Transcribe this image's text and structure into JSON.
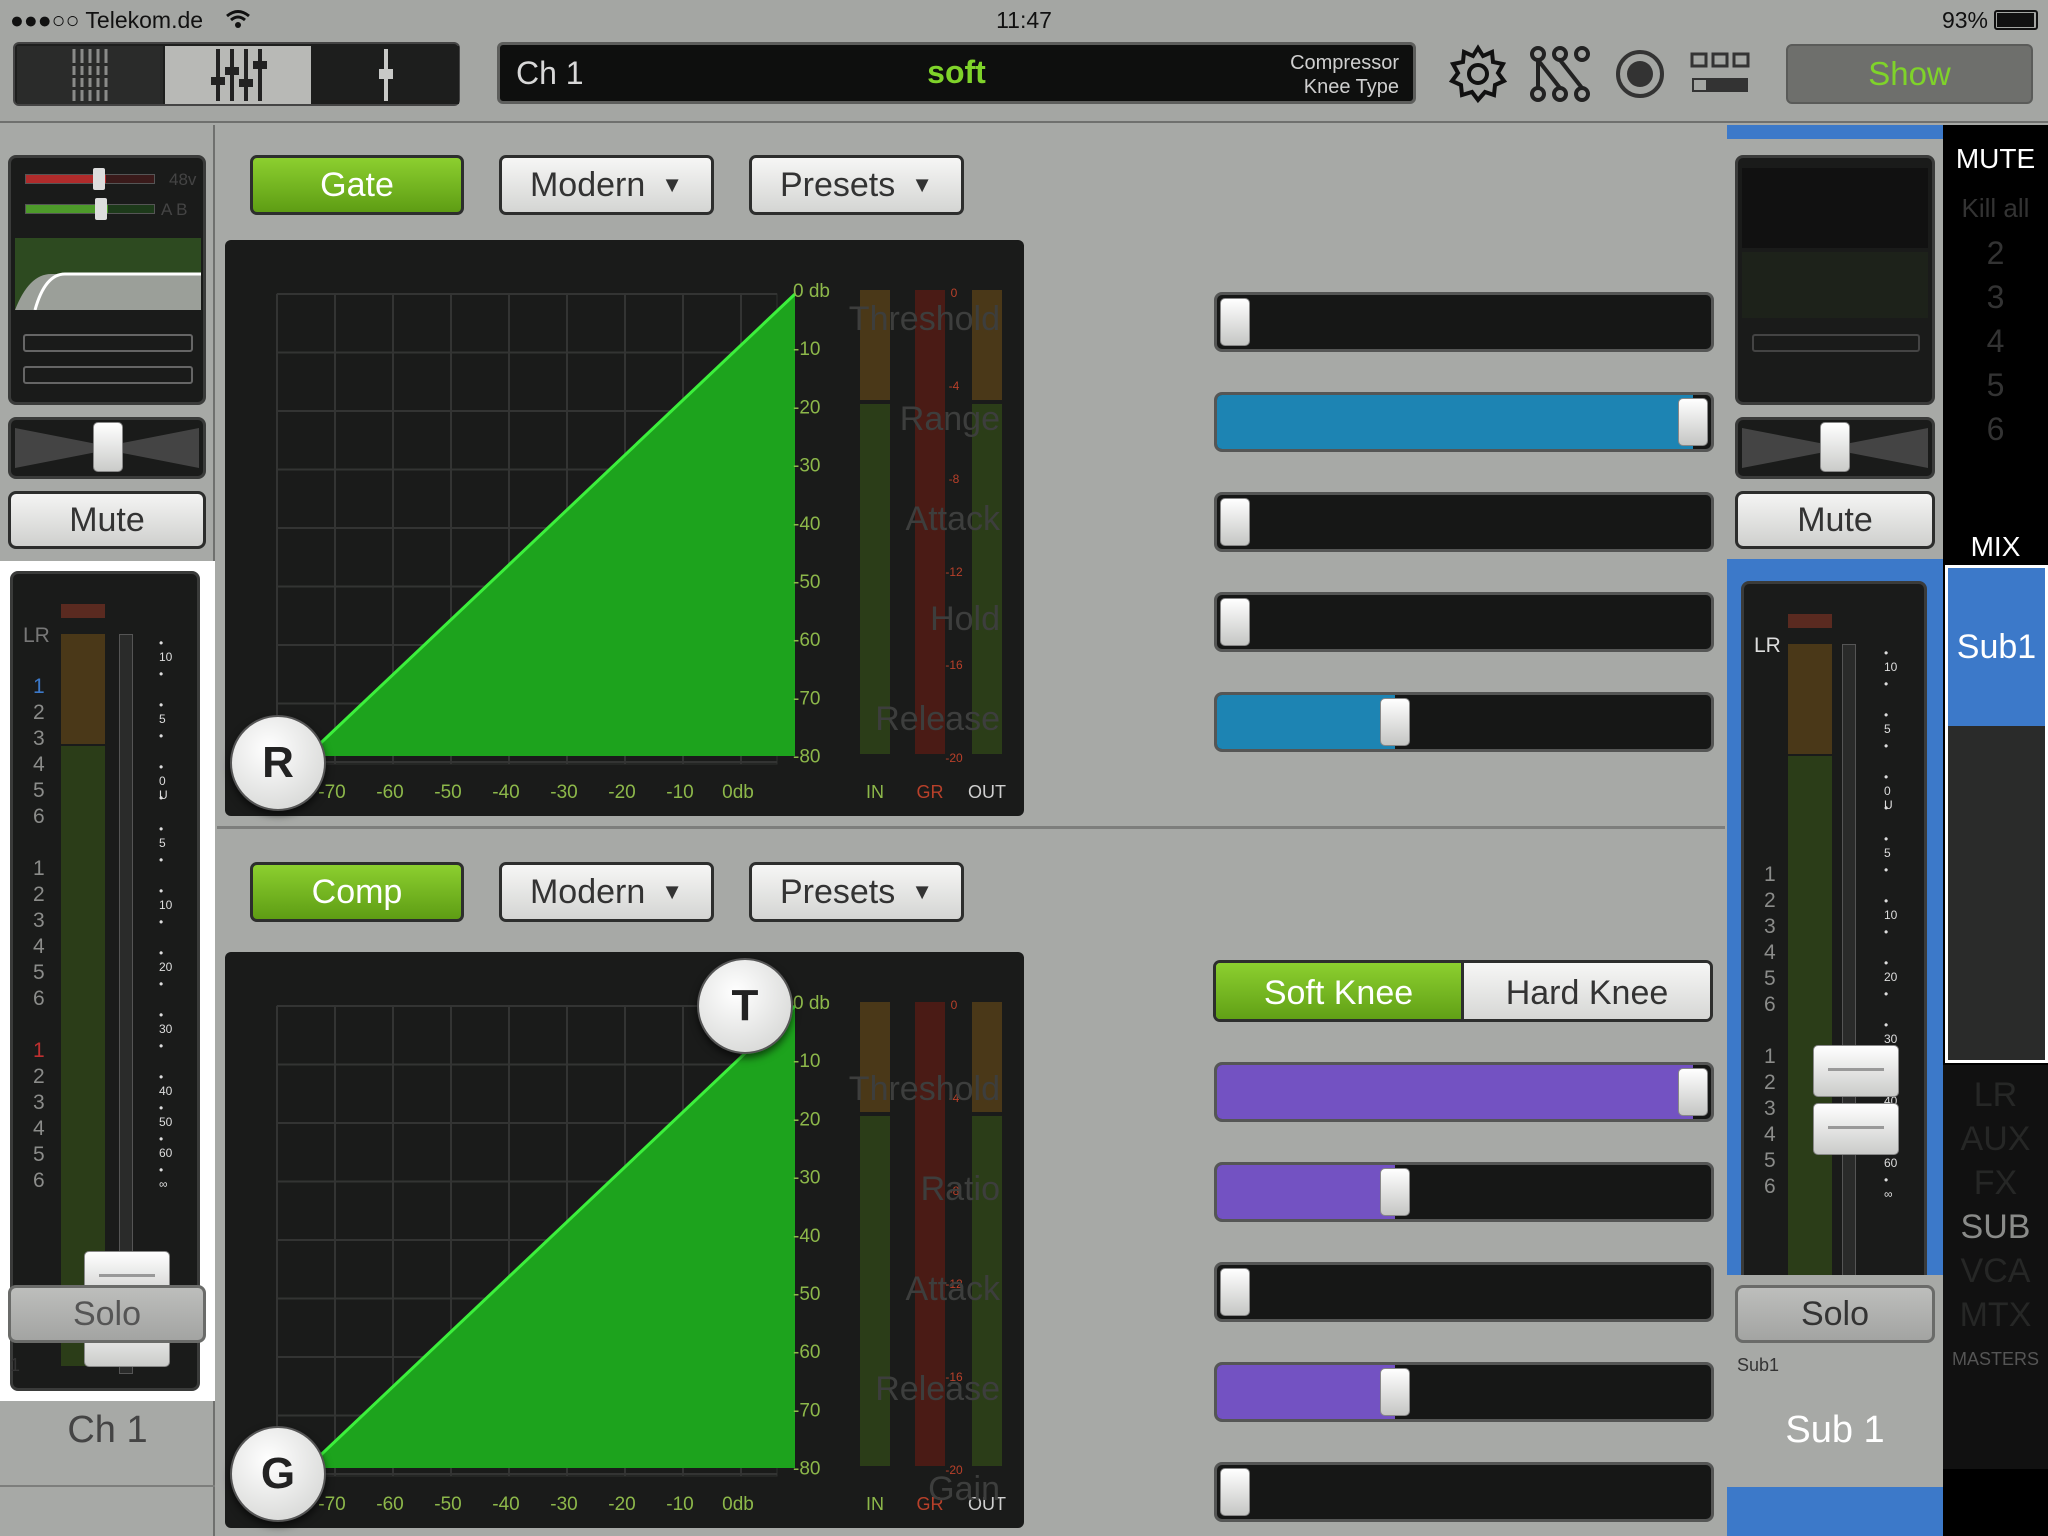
{
  "status": {
    "carrier": "●●●○○ Telekom.de",
    "time": "11:47",
    "battery": "93%"
  },
  "lcd": {
    "channel": "Ch 1",
    "value": "soft",
    "label_line1": "Compressor",
    "label_line2": "Knee Type"
  },
  "toolbar": {
    "show_label": "Show"
  },
  "left_strip": {
    "mini_labels": [
      "48v",
      "A B"
    ],
    "mute_label": "Mute",
    "solo_label": "Solo",
    "meter_label": "LR",
    "channel_number": "1",
    "channel_name": "Ch 1",
    "bus_groups": [
      [
        "1",
        "2",
        "3",
        "4",
        "5",
        "6"
      ],
      [
        "1",
        "2",
        "3",
        "4",
        "5",
        "6"
      ],
      [
        "1",
        "2",
        "3",
        "4",
        "5",
        "6"
      ]
    ],
    "scale": [
      "10",
      "",
      "5",
      "",
      "0 U",
      "",
      "5",
      "",
      "10",
      "",
      "20",
      "",
      "30",
      "",
      "40",
      "50",
      "60",
      "∞"
    ]
  },
  "gate": {
    "enable_label": "Gate",
    "mode_label": "Modern",
    "presets_label": "Presets",
    "handle_label": "R",
    "y_ticks": [
      "0 db",
      "-10",
      "-20",
      "-30",
      "-40",
      "-50",
      "-60",
      "-70",
      "-80"
    ],
    "x_ticks": [
      "-70",
      "-60",
      "-50",
      "-40",
      "-30",
      "-20",
      "-10",
      "0db"
    ],
    "gr_ticks": [
      "0",
      "-4",
      "-8",
      "-12",
      "-16",
      "-20"
    ],
    "meter_labels": [
      "IN",
      "GR",
      "OUT"
    ],
    "params": [
      {
        "label": "Threshold",
        "value": 0.0
      },
      {
        "label": "Range",
        "value": 1.0
      },
      {
        "label": "Attack",
        "value": 0.0
      },
      {
        "label": "Hold",
        "value": 0.0
      },
      {
        "label": "Release",
        "value": 0.35
      }
    ]
  },
  "comp": {
    "enable_label": "Comp",
    "mode_label": "Modern",
    "presets_label": "Presets",
    "handle_top_label": "T",
    "handle_bottom_label": "G",
    "soft_knee_label": "Soft Knee",
    "hard_knee_label": "Hard Knee",
    "y_ticks": [
      "0 db",
      "-10",
      "-20",
      "-30",
      "-40",
      "-50",
      "-60",
      "-70",
      "-80"
    ],
    "x_ticks": [
      "-70",
      "-60",
      "-50",
      "-40",
      "-30",
      "-20",
      "-10",
      "0db"
    ],
    "gr_ticks": [
      "0",
      "-4",
      "-8",
      "-12",
      "-16",
      "-20"
    ],
    "meter_labels": [
      "IN",
      "GR",
      "OUT"
    ],
    "params": [
      {
        "label": "Threshold",
        "value": 1.0
      },
      {
        "label": "Ratio",
        "value": 0.35
      },
      {
        "label": "Attack",
        "value": 0.0
      },
      {
        "label": "Release",
        "value": 0.35
      },
      {
        "label": "Gain",
        "value": 0.0
      }
    ]
  },
  "right_strip": {
    "mute_label": "Mute",
    "solo_label": "Solo",
    "meter_label": "LR",
    "channel_sub": "Sub1",
    "channel_name": "Sub 1",
    "bus_groups": [
      [
        "1",
        "2",
        "3",
        "4",
        "5",
        "6"
      ],
      [
        "1",
        "2",
        "3",
        "4",
        "5",
        "6"
      ]
    ],
    "scale": [
      "10",
      "",
      "5",
      "",
      "0 U",
      "",
      "5",
      "",
      "10",
      "",
      "20",
      "",
      "30",
      "",
      "40",
      "50",
      "60",
      "∞"
    ]
  },
  "masters": {
    "mute_title": "MUTE",
    "kill_all": "Kill all",
    "mute_groups": [
      "2",
      "3",
      "4",
      "5",
      "6"
    ],
    "mix_title": "MIX",
    "mix_selected": "Sub1",
    "categories": [
      "LR",
      "AUX",
      "FX",
      "SUB",
      "VCA",
      "MTX"
    ],
    "footer": "MASTERS"
  },
  "colors": {
    "accent_green": "#7fd32a",
    "gate_slider": "#1d84b3",
    "comp_slider": "#7352c2",
    "graph_fill": "#1da31d",
    "selected_blue": "#3c79c9"
  }
}
